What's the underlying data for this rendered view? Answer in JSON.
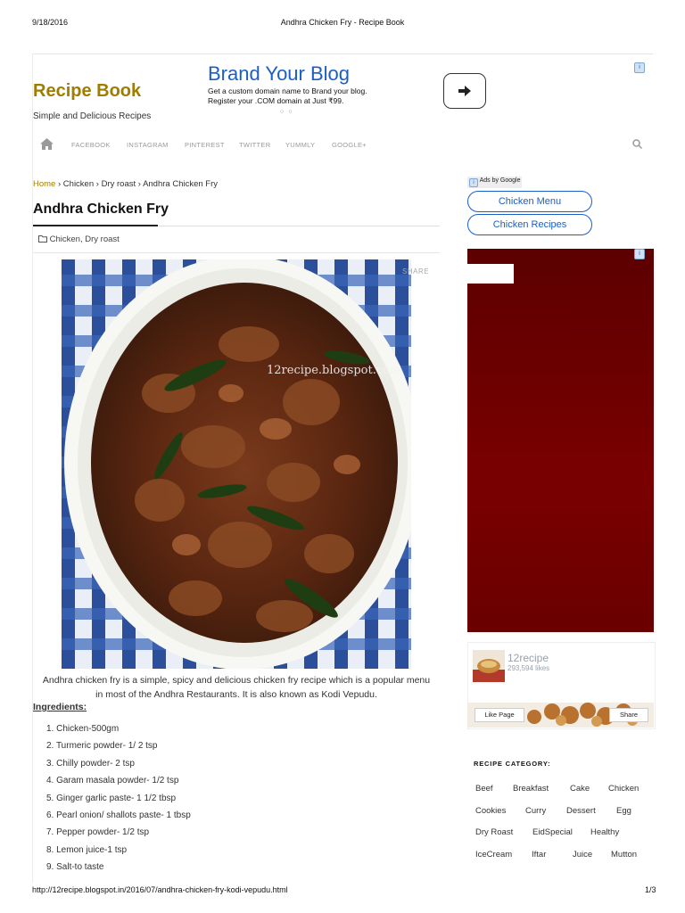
{
  "print_header": {
    "date": "9/18/2016",
    "title": "Andhra Chicken Fry - Recipe Book"
  },
  "print_footer": {
    "url": "http://12recipe.blogspot.in/2016/07/andhra-chicken-fry-kodi-vepudu.html",
    "page": "1/3"
  },
  "site": {
    "title": "Recipe Book",
    "tagline": "Simple and Delicious Recipes"
  },
  "top_ad": {
    "headline": "Brand Your Blog",
    "line1": "Get a custom domain name to Brand your blog.",
    "line2": "Register your .COM domain at Just ₹99.",
    "dots": "○○"
  },
  "nav": {
    "items": [
      "FACEBOOK",
      "INSTAGRAM",
      "PINTEREST",
      "TWITTER",
      "YUMMLY",
      "GOOGLE+"
    ]
  },
  "breadcrumb": {
    "home": "Home",
    "sep": "›",
    "items": [
      "Chicken",
      "Dry roast",
      "Andhra Chicken Fry"
    ]
  },
  "post": {
    "title": "Andhra Chicken Fry",
    "categories": "Chicken, Dry roast",
    "share_label": "SHARE",
    "watermark": "12recipe.blogspot.com",
    "intro_line1": "Andhra chicken fry is a simple, spicy and delicious chicken fry recipe which is a popular menu",
    "intro_line2": "in most of the Andhra Restaurants. It is also known as Kodi Vepudu.",
    "ingredients_heading": "Ingredients:",
    "ingredients": [
      "1. Chicken-500gm",
      "2. Turmeric powder- 1/ 2 tsp",
      "3. Chilly powder- 2 tsp",
      "4. Garam masala powder- 1/2 tsp",
      "5. Ginger garlic paste- 1 1/2 tbsp",
      "6. Pearl onion/ shallots paste- 1 tbsp",
      "7. Pepper powder- 1/2 tsp",
      "8. Lemon juice-1 tsp",
      "9. Salt-to taste"
    ]
  },
  "sidebar": {
    "ads_by": "Ads by Google",
    "links": [
      "Chicken Menu",
      "Chicken Recipes"
    ],
    "fb_page": {
      "name": "12recipe",
      "likes": "293,594 likes",
      "like_btn": "Like Page",
      "share_btn": "Share"
    },
    "recipe_category_heading": "RECIPE CATEGORY:",
    "tags": [
      [
        "Beef",
        "Breakfast",
        "Cake",
        "Chicken"
      ],
      [
        "Cookies",
        "Curry",
        "Dessert",
        "Egg"
      ],
      [
        "Dry Roast",
        "EidSpecial",
        "Healthy"
      ],
      [
        "IceCream",
        "Iftar",
        "Juice",
        "Mutton"
      ]
    ]
  },
  "colors": {
    "site_title": "#a07c00",
    "link_blue": "#1a5fc7",
    "ad_red": "#6a0000"
  }
}
